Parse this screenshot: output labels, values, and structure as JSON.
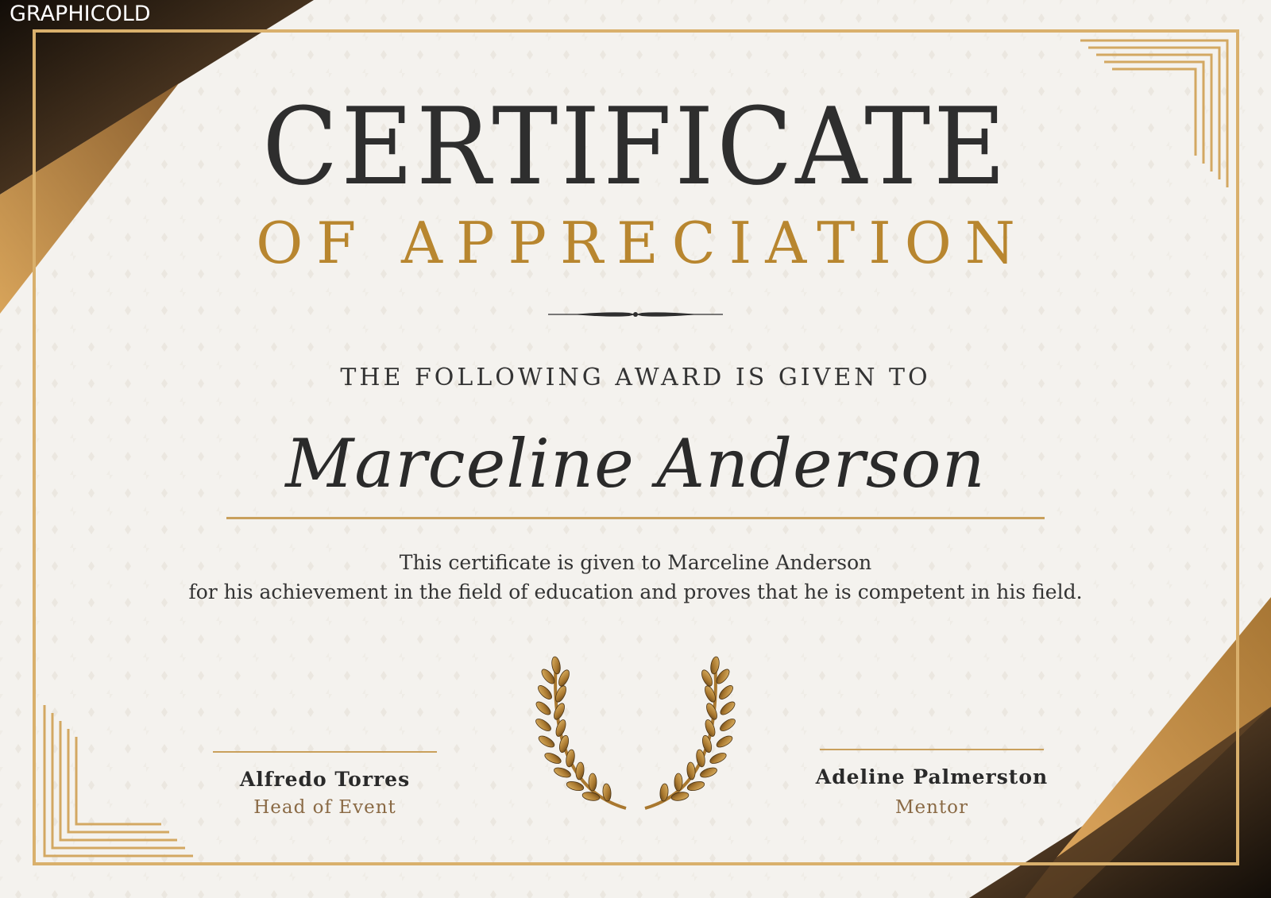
{
  "watermark": "GRAPHICOLD",
  "certificate": {
    "title": "CERTIFICATE",
    "subtitle": "OF APPRECIATION",
    "award_line": "THE FOLLOWING AWARD IS GIVEN TO",
    "recipient": "Marceline Anderson",
    "description_line1": "This certificate is given to Marceline Anderson",
    "description_line2": "for his achievement in the field of education and proves that he is competent in his field."
  },
  "signatories": [
    {
      "name": "Alfredo Torres",
      "role": "Head of Event"
    },
    {
      "name": "Adeline Palmerston",
      "role": "Mentor"
    }
  ],
  "colors": {
    "gold": "#c9a05c",
    "gold_text": "#b8862f",
    "dark_text": "#2e2e2e",
    "background": "#f4f2ee",
    "dark_brown": "#2a1d10"
  },
  "icons": {
    "emblem": "laurel-wreath-icon",
    "divider": "ornamental-divider-icon"
  }
}
